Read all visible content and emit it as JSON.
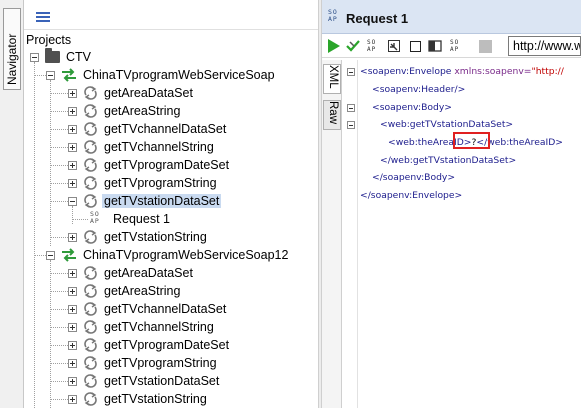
{
  "navigator": {
    "tab_label": "Navigator"
  },
  "tree": {
    "root_label": "Projects",
    "project": "CTV",
    "interfaces": [
      {
        "name": "ChinaTVprogramWebServiceSoap",
        "operations": [
          "getAreaDataSet",
          "getAreaString",
          "getTVchannelDataSet",
          "getTVchannelString",
          "getTVprogramDateSet",
          "getTVprogramString",
          "getTVstationDataSet",
          "getTVstationString"
        ],
        "selected_operation": "getTVstationDataSet",
        "request": "Request 1"
      },
      {
        "name": "ChinaTVprogramWebServiceSoap12",
        "operations": [
          "getAreaDataSet",
          "getAreaString",
          "getTVchannelDataSet",
          "getTVchannelString",
          "getTVprogramDateSet",
          "getTVprogramString",
          "getTVstationDataSet",
          "getTVstationString"
        ]
      }
    ]
  },
  "editor": {
    "title": "Request 1",
    "endpoint": "http://www.w",
    "tabs": {
      "xml": "XML",
      "raw": "Raw"
    },
    "xml": {
      "envelope_open_tag": "<soapenv:Envelope",
      "envelope_attr": " xmlns:soapenv=",
      "envelope_value": "\"http://",
      "header": "<soapenv:Header/>",
      "body_open": "<soapenv:Body>",
      "op_open": "<web:getTVstationDataSet>",
      "area_open": "<web:theAre",
      "area_mid": "aID>",
      "area_value": "?",
      "area_close_a": "</",
      "area_close_b": "web:theAreaID>",
      "op_close": "</web:getTVstationDataSet>",
      "body_close": "</soapenv:Body>",
      "envelope_close": "</soapenv:Envelope>"
    }
  },
  "colors": {
    "selection": "#c9daf0",
    "header_bg": "#dbe5f3",
    "run_green": "#2aa52a",
    "highlight_red": "#e02020",
    "interface_green": "#2e9a3a"
  },
  "icons": {
    "list": "list-icon",
    "folder": "folder-icon",
    "interface": "interface-arrows-icon",
    "operation": "operation-cycle-icon",
    "request": "soap-request-icon",
    "run": "play-icon"
  }
}
